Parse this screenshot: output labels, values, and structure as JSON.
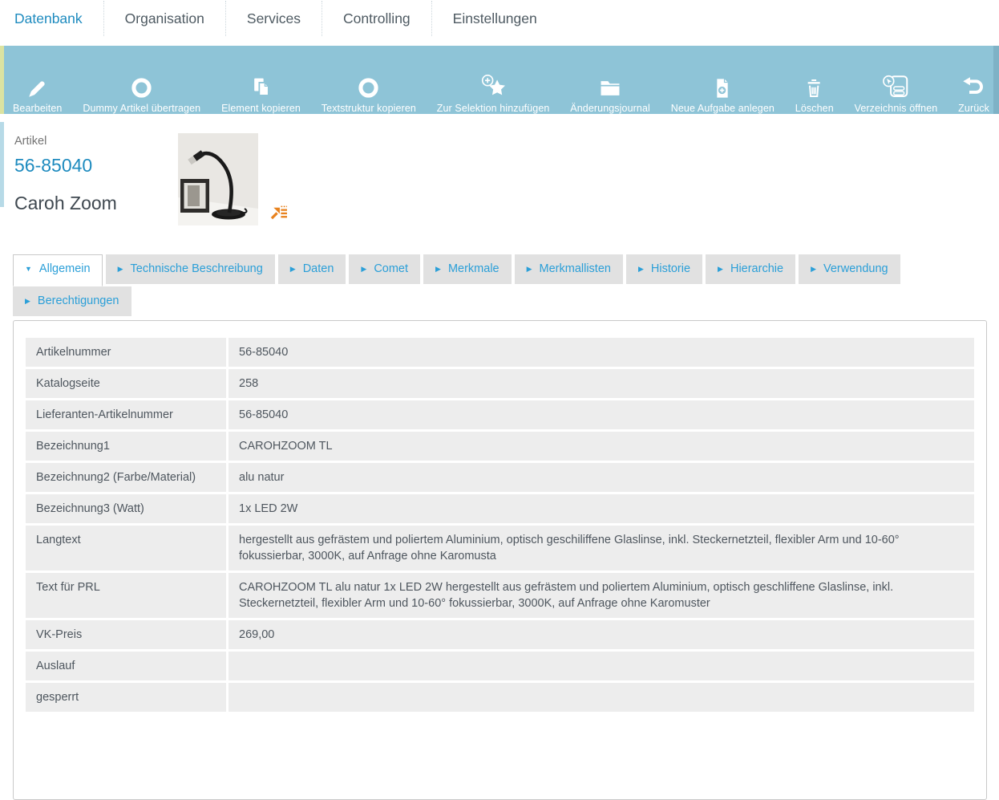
{
  "colors": {
    "accent_blue": "#1e8bbf",
    "tab_blue": "#2b9fd8",
    "toolbar_bg": "#8ec4d7",
    "toolbar_edge_left": "#dbe3a1",
    "toolbar_edge_right": "#7eb2c6",
    "header_accent": "#b7dae7",
    "row_bg": "#ededed",
    "orange_icon": "#e8821e"
  },
  "nav": {
    "items": [
      {
        "label": "Datenbank",
        "active": true
      },
      {
        "label": "Organisation",
        "active": false
      },
      {
        "label": "Services",
        "active": false
      },
      {
        "label": "Controlling",
        "active": false
      },
      {
        "label": "Einstellungen",
        "active": false
      }
    ]
  },
  "toolbar": {
    "items": [
      {
        "label": "Bearbeiten",
        "icon": "pencil-icon"
      },
      {
        "label": "Dummy Artikel übertragen",
        "icon": "circle-icon"
      },
      {
        "label": "Element kopieren",
        "icon": "copy-icon"
      },
      {
        "label": "Textstruktur kopieren",
        "icon": "circle-icon"
      },
      {
        "label": "Zur Selektion hinzufügen",
        "icon": "star-plus-icon"
      },
      {
        "label": "Änderungsjournal",
        "icon": "folder-icon"
      },
      {
        "label": "Neue Aufgabe anlegen",
        "icon": "document-plus-icon"
      },
      {
        "label": "Löschen",
        "icon": "trash-icon"
      },
      {
        "label": "Verzeichnis öffnen",
        "icon": "directory-cursor-icon"
      },
      {
        "label": "Zurück",
        "icon": "undo-icon"
      }
    ]
  },
  "article": {
    "type_label": "Artikel",
    "number": "56-85040",
    "name": "Caroh Zoom"
  },
  "tabs": {
    "rows": [
      [
        {
          "label": "Allgemein",
          "active": true
        },
        {
          "label": "Technische Beschreibung",
          "active": false
        },
        {
          "label": "Daten",
          "active": false
        },
        {
          "label": "Comet",
          "active": false
        },
        {
          "label": "Merkmale",
          "active": false
        },
        {
          "label": "Merkmallisten",
          "active": false
        },
        {
          "label": "Historie",
          "active": false
        },
        {
          "label": "Hierarchie",
          "active": false
        },
        {
          "label": "Verwendung",
          "active": false
        }
      ],
      [
        {
          "label": "Berechtigungen",
          "active": false
        }
      ]
    ]
  },
  "form": {
    "rows": [
      {
        "label": "Artikelnummer",
        "value": "56-85040"
      },
      {
        "label": "Katalogseite",
        "value": "258"
      },
      {
        "label": "Lieferanten-Artikelnummer",
        "value": "56-85040"
      },
      {
        "label": "Bezeichnung1",
        "value": "CAROHZOOM TL"
      },
      {
        "label": "Bezeichnung2 (Farbe/Material)",
        "value": "alu natur"
      },
      {
        "label": "Bezeichnung3 (Watt)",
        "value": "1x LED 2W"
      },
      {
        "label": "Langtext",
        "value": "hergestellt aus gefrästem und poliertem Aluminium, optisch geschiliffene Glaslinse, inkl. Steckernetzteil, flexibler Arm und 10-60° fokussierbar, 3000K, auf Anfrage ohne Karomusta"
      },
      {
        "label": "Text für PRL",
        "value": "CAROHZOOM TL alu natur 1x LED 2W hergestellt aus gefrästem und poliertem Aluminium, optisch geschliffene Glaslinse, inkl. Steckernetzteil, flexibler Arm und 10-60° fokussierbar, 3000K, auf Anfrage ohne Karomuster"
      },
      {
        "label": "VK-Preis",
        "value": "269,00"
      },
      {
        "label": "Auslauf",
        "value": ""
      },
      {
        "label": "gesperrt",
        "value": ""
      }
    ]
  }
}
